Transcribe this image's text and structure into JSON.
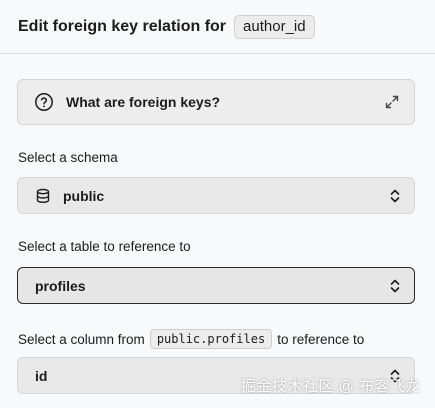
{
  "header": {
    "title": "Edit foreign key relation for",
    "column": "author_id"
  },
  "info": {
    "label": "What are foreign keys?",
    "icon": "help-circle-icon",
    "expand_icon": "expand-icon"
  },
  "schema": {
    "label": "Select a schema",
    "value": "public",
    "icon": "database-icon"
  },
  "table": {
    "label": "Select a table to reference to",
    "value": "profiles"
  },
  "column": {
    "label_prefix": "Select a column from",
    "table_ref": "public.profiles",
    "label_suffix": "to reference to",
    "value": "id"
  },
  "watermark": "掘金技术社区 @ 布客飞龙"
}
